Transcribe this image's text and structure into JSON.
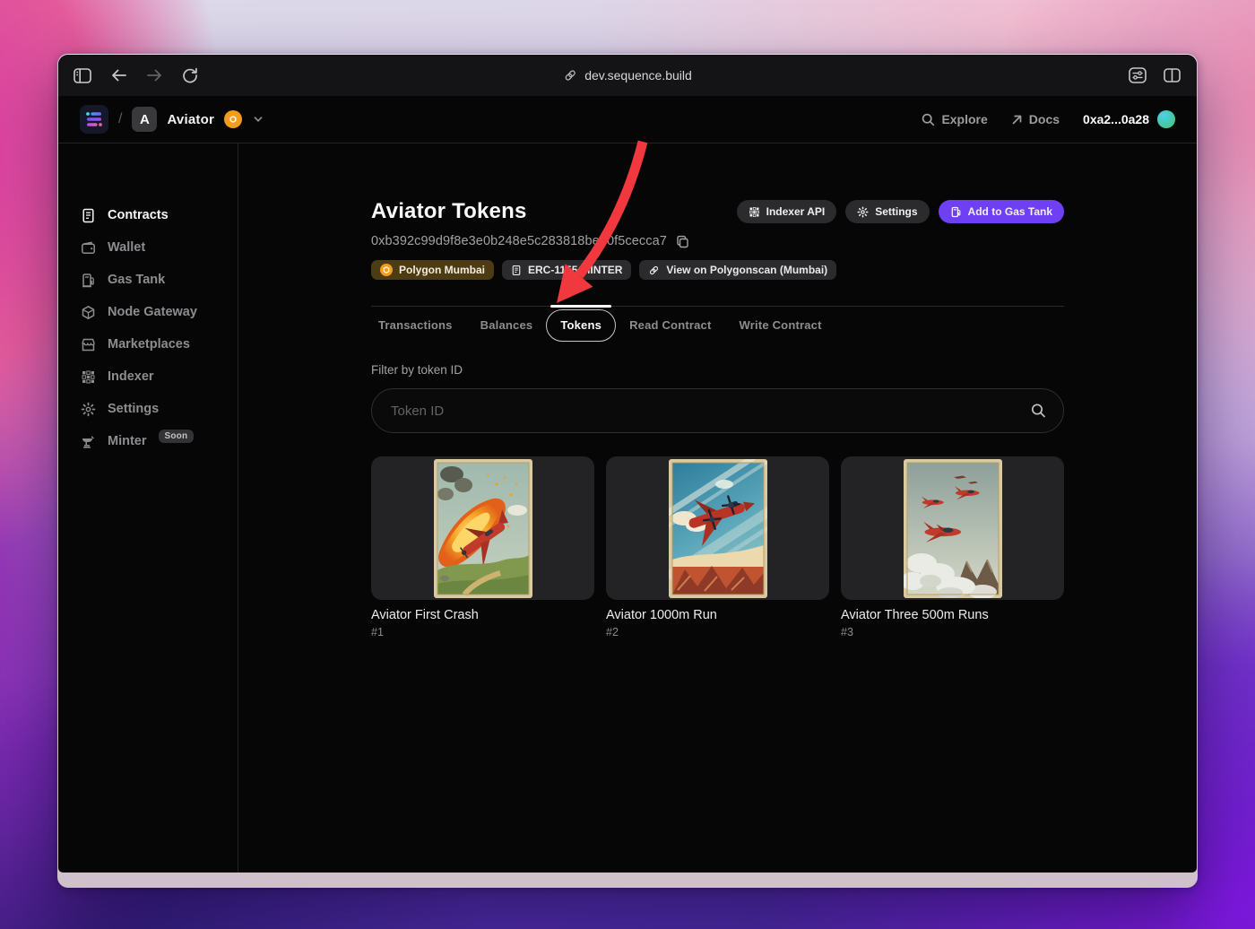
{
  "browser": {
    "url": "dev.sequence.build"
  },
  "header": {
    "breadcrumb_separator": "/",
    "project_initial": "A",
    "project_name": "Aviator",
    "explore_label": "Explore",
    "docs_label": "Docs",
    "wallet_address": "0xa2...0a28"
  },
  "sidebar": {
    "items": [
      {
        "label": "Contracts",
        "active": true
      },
      {
        "label": "Wallet"
      },
      {
        "label": "Gas Tank"
      },
      {
        "label": "Node Gateway"
      },
      {
        "label": "Marketplaces"
      },
      {
        "label": "Indexer"
      },
      {
        "label": "Settings"
      },
      {
        "label": "Minter",
        "badge": "Soon"
      }
    ]
  },
  "page": {
    "title": "Aviator Tokens",
    "contract_address": "0xb392c99d9f8e3e0b248e5c283818beb0f5cecca7",
    "actions": {
      "indexer_api": "Indexer API",
      "settings": "Settings",
      "add_to_gas_tank": "Add to Gas Tank"
    },
    "badges": {
      "network": "Polygon Mumbai",
      "contract_type": "ERC-1155-MINTER",
      "explorer_link": "View on Polygonscan (Mumbai)"
    },
    "tabs": [
      {
        "label": "Transactions"
      },
      {
        "label": "Balances"
      },
      {
        "label": "Tokens",
        "active": true
      },
      {
        "label": "Read Contract"
      },
      {
        "label": "Write Contract"
      }
    ],
    "filter_label": "Filter by token ID",
    "search_placeholder": "Token ID",
    "tokens": [
      {
        "name": "Aviator First Crash",
        "token_id": "#1"
      },
      {
        "name": "Aviator 1000m Run",
        "token_id": "#2"
      },
      {
        "name": "Aviator Three 500m Runs",
        "token_id": "#3"
      }
    ]
  },
  "colors": {
    "accent_purple": "#6e3ff3",
    "annotation_red": "#f2383f",
    "network_badge_bg": "#4d3b13",
    "polygon_orange": "#f49c1d"
  }
}
